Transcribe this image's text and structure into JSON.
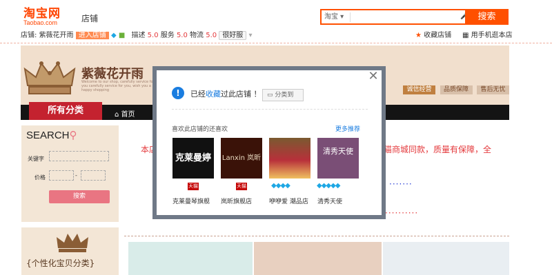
{
  "header": {
    "logo_cn": "淘宝网",
    "logo_en": "Taobao.com",
    "store_label": "店铺",
    "search_scope": "淘宝",
    "search_button": "搜索"
  },
  "shopbar": {
    "shop_prefix": "店铺:",
    "shop_name": "紫薇花开雨",
    "enter_store": "进入店铺",
    "desc_label": "描述",
    "desc_value": "5.0",
    "service_label": "服务",
    "service_value": "5.0",
    "logistics_label": "物流",
    "logistics_value": "5.0",
    "good_button": "很好服",
    "favorite": "收藏店铺",
    "mobile": "用手机逛本店"
  },
  "banner": {
    "shop_title": "紫薇花开雨",
    "welcome": "Welcome to our shop, carefully service for you carefully service for you, wish you a happy shopping",
    "badges": [
      "诚信经营",
      "品质保障",
      "售后无忧"
    ],
    "nav_all": "所有分类",
    "nav_home": "首页"
  },
  "left_search": {
    "title": "SEARCH",
    "keyword_label": "关键字",
    "price_label": "价格",
    "price_dash": "-",
    "button": "搜索",
    "personal": "个性化宝贝分类"
  },
  "content": {
    "red_text_start": "本店",
    "red_text_end": "猫商城同款，质量有保障，全",
    "dots_blue": "·······",
    "dots_red": "··········"
  },
  "modal": {
    "msg_prefix": "已经",
    "msg_link": "收藏",
    "msg_suffix": "过此店铺 ！",
    "category_button": "分类到",
    "like_title": "喜欢此店铺的还喜欢",
    "more": "更多推荐",
    "tmall_label": "天猫",
    "shops": [
      {
        "name": "克莱曼琴旗舰",
        "img_text": "克莱曼婷",
        "badge": "tmall"
      },
      {
        "name": "岚昕旗舰店",
        "img_text": "Lanxin 岚昕",
        "badge": "tmall"
      },
      {
        "name": "咿咿爱 潮品店",
        "img_text": "",
        "badge": "diamond"
      },
      {
        "name": "清秀天使",
        "img_text": "清秀天使",
        "badge": "diamond"
      }
    ],
    "diamonds": "◆◆◆◆",
    "diamonds5": "◆◆◆◆◆"
  },
  "colors": {
    "accent": "#ff5000",
    "tmall_red": "#c40000",
    "link_blue": "#1a7de0",
    "nav_red": "#c4222f"
  }
}
